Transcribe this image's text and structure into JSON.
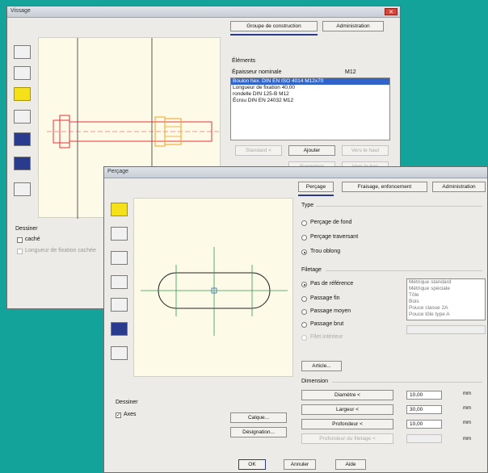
{
  "back_window": {
    "title": "Vissage",
    "close": "✕",
    "tabs": [
      "Groupe de construction",
      "Administration"
    ],
    "elements_label": "Éléments",
    "epaisseur_label": "Épaisseur nominale",
    "epaisseur_value": "M12",
    "elements": [
      "Boulon hex. DIN EN ISO 4014 M12x70",
      "Longueur de fixation 40,00",
      "rondelle DIN 125-B M12",
      "Écrou DIN EN 24032 M12"
    ],
    "buttons": [
      "Standard <",
      "Ajouter",
      "Vers le haut",
      "Supprimer",
      "Vers le bas"
    ],
    "dessiner_label": "Dessiner",
    "checkboxes": [
      "caché",
      "Longueur de fixation cachée"
    ]
  },
  "front_window": {
    "title": "Perçage",
    "tabs": [
      "Perçage",
      "Fraisage, enfoncement",
      "Administration"
    ],
    "type_label": "Type",
    "type_options": [
      "Perçage de fond",
      "Perçage traversant",
      "Trou oblong"
    ],
    "filetage_label": "Filetage",
    "filetage_options": [
      "Pas de référence",
      "Passage fin",
      "Passage moyen",
      "Passage brut",
      "Filet intérieur"
    ],
    "thread_list": [
      "Métrique standard",
      "Métrique spéciale",
      "Tôle",
      "Bois",
      "Pouce classe 2A",
      "Pouce tôle type A"
    ],
    "article_button": "Article...",
    "dimension_label": "Dimension",
    "dimension_rows": [
      {
        "label": "Diamètre <",
        "value": "10,00",
        "unit": "mm"
      },
      {
        "label": "Largeur <",
        "value": "30,00",
        "unit": "mm"
      },
      {
        "label": "Profondeur <",
        "value": "10,00",
        "unit": "mm"
      },
      {
        "label": "Profondeur du filetage <",
        "value": "",
        "unit": "mm"
      }
    ],
    "dessiner_label": "Dessiner",
    "axes_label": "Axes",
    "calque_button": "Calque...",
    "designation_button": "Désignation...",
    "ok_button": "OK",
    "annuler_button": "Annuler",
    "aide_button": "Aide"
  },
  "colors": {
    "background": "#14a39a",
    "selection": "#3064c8",
    "highlight_icon": "#f5e11a",
    "drawing_red": "#e8323c",
    "drawing_orange": "#f0a020",
    "axis_green": "#2e9a4c"
  }
}
